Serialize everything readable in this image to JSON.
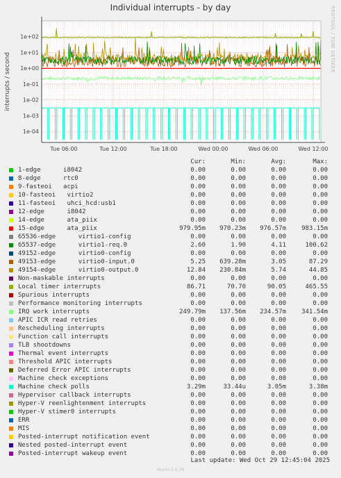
{
  "title": "Individual interrupts - by day",
  "side_label": "RRDTOOL / TOBI OETIKER",
  "columns": [
    "Cur:",
    "Min:",
    "Avg:",
    "Max:"
  ],
  "last_update": "Last update: Wed Oct 29 12:45:04 2025",
  "footer": "Munin 2.0.76",
  "chart_data": {
    "type": "line",
    "ylabel": "interrupts / second",
    "yscale": "log",
    "ylim": [
      2e-05,
      1000
    ],
    "y_ticks": [
      "1e+02",
      "1e+01",
      "1e+00",
      "1e-01",
      "1e-02",
      "1e-03",
      "1e-04"
    ],
    "y_tick_values": [
      100,
      10,
      1,
      0.1,
      0.01,
      0.001,
      0.0001
    ],
    "x_ticks": [
      "Tue 06:00",
      "Tue 12:00",
      "Tue 18:00",
      "Wed 00:00",
      "Wed 06:00",
      "Wed 12:00"
    ],
    "grid": true,
    "series": [
      {
        "name": "1-edge      i8042",
        "color": "#00cc00",
        "cur": "0.00",
        "min": "0.00",
        "avg": "0.00",
        "max": "0.00"
      },
      {
        "name": "8-edge      rtc0",
        "color": "#0066b3",
        "cur": "0.00",
        "min": "0.00",
        "avg": "0.00",
        "max": "0.00"
      },
      {
        "name": "9-fasteoi   acpi",
        "color": "#ff8000",
        "cur": "0.00",
        "min": "0.00",
        "avg": "0.00",
        "max": "0.00"
      },
      {
        "name": "10-fasteoi   virtio2",
        "color": "#ffcc00",
        "cur": "0.00",
        "min": "0.00",
        "avg": "0.00",
        "max": "0.00"
      },
      {
        "name": "11-fasteoi   uhci_hcd:usb1",
        "color": "#330099",
        "cur": "0.00",
        "min": "0.00",
        "avg": "0.00",
        "max": "0.00"
      },
      {
        "name": "12-edge      i8042",
        "color": "#990099",
        "cur": "0.00",
        "min": "0.00",
        "avg": "0.00",
        "max": "0.00"
      },
      {
        "name": "14-edge      ata_piix",
        "color": "#ccff00",
        "cur": "0.00",
        "min": "0.00",
        "avg": "0.00",
        "max": "0.00"
      },
      {
        "name": "15-edge      ata_piix",
        "color": "#ff0000",
        "cur": "979.95m",
        "min": "970.23m",
        "avg": "976.57m",
        "max": "983.15m"
      },
      {
        "name": "65536-edge      virtio1-config",
        "color": "#808080",
        "cur": "0.00",
        "min": "0.00",
        "avg": "0.00",
        "max": "0.00"
      },
      {
        "name": "65537-edge      virtio1-req.0",
        "color": "#008f00",
        "cur": "2.60",
        "min": "1.90",
        "avg": "4.11",
        "max": "100.62"
      },
      {
        "name": "49152-edge      virtio0-config",
        "color": "#00487d",
        "cur": "0.00",
        "min": "0.00",
        "avg": "0.00",
        "max": "0.00"
      },
      {
        "name": "49153-edge      virtio0-input.0",
        "color": "#b35a00",
        "cur": "5.25",
        "min": "639.28m",
        "avg": "3.05",
        "max": "87.29"
      },
      {
        "name": "49154-edge      virtio0-output.0",
        "color": "#b38f00",
        "cur": "12.84",
        "min": "230.84m",
        "avg": "5.74",
        "max": "44.85"
      },
      {
        "name": "Non-maskable interrupts",
        "color": "#6b006b",
        "cur": "0.00",
        "min": "0.00",
        "avg": "0.00",
        "max": "0.00"
      },
      {
        "name": "Local timer interrupts",
        "color": "#8fb300",
        "cur": "86.71",
        "min": "70.70",
        "avg": "90.05",
        "max": "465.55"
      },
      {
        "name": "Spurious interrupts",
        "color": "#b30000",
        "cur": "0.00",
        "min": "0.00",
        "avg": "0.00",
        "max": "0.00"
      },
      {
        "name": "Performance monitoring interrupts",
        "color": "#bebebe",
        "cur": "0.00",
        "min": "0.00",
        "avg": "0.00",
        "max": "0.00"
      },
      {
        "name": "IRQ work interrupts",
        "color": "#80ff80",
        "cur": "249.79m",
        "min": "137.56m",
        "avg": "234.57m",
        "max": "341.54m"
      },
      {
        "name": "APIC ICR read retries",
        "color": "#80c9ff",
        "cur": "0.00",
        "min": "0.00",
        "avg": "0.00",
        "max": "0.00"
      },
      {
        "name": "Rescheduling interrupts",
        "color": "#ffc080",
        "cur": "0.00",
        "min": "0.00",
        "avg": "0.00",
        "max": "0.00"
      },
      {
        "name": "Function call interrupts",
        "color": "#ffe680",
        "cur": "0.00",
        "min": "0.00",
        "avg": "0.00",
        "max": "0.00"
      },
      {
        "name": "TLB shootdowns",
        "color": "#aa80ff",
        "cur": "0.00",
        "min": "0.00",
        "avg": "0.00",
        "max": "0.00"
      },
      {
        "name": "Thermal event interrupts",
        "color": "#ee00cc",
        "cur": "0.00",
        "min": "0.00",
        "avg": "0.00",
        "max": "0.00"
      },
      {
        "name": "Threshold APIC interrupts",
        "color": "#ff8080",
        "cur": "0.00",
        "min": "0.00",
        "avg": "0.00",
        "max": "0.00"
      },
      {
        "name": "Deferred Error APIC interrupts",
        "color": "#666600",
        "cur": "0.00",
        "min": "0.00",
        "avg": "0.00",
        "max": "0.00"
      },
      {
        "name": "Machine check exceptions",
        "color": "#ffbfff",
        "cur": "0.00",
        "min": "0.00",
        "avg": "0.00",
        "max": "0.00"
      },
      {
        "name": "Machine check polls",
        "color": "#00ffcc",
        "cur": "3.29m",
        "min": "33.44u",
        "avg": "3.05m",
        "max": "3.38m"
      },
      {
        "name": "Hypervisor callback interrupts",
        "color": "#cc6699",
        "cur": "0.00",
        "min": "0.00",
        "avg": "0.00",
        "max": "0.00"
      },
      {
        "name": "Hyper-V reenlightenment interrupts",
        "color": "#999900",
        "cur": "0.00",
        "min": "0.00",
        "avg": "0.00",
        "max": "0.00"
      },
      {
        "name": "Hyper-V stimer0 interrupts",
        "color": "#00cc00",
        "cur": "0.00",
        "min": "0.00",
        "avg": "0.00",
        "max": "0.00"
      },
      {
        "name": "ERR",
        "color": "#0066b3",
        "cur": "0.00",
        "min": "0.00",
        "avg": "0.00",
        "max": "0.00"
      },
      {
        "name": "MIS",
        "color": "#ff8000",
        "cur": "0.00",
        "min": "0.00",
        "avg": "0.00",
        "max": "0.00"
      },
      {
        "name": "Posted-interrupt notification event",
        "color": "#ffcc00",
        "cur": "0.00",
        "min": "0.00",
        "avg": "0.00",
        "max": "0.00"
      },
      {
        "name": "Nested posted-interrupt event",
        "color": "#330099",
        "cur": "0.00",
        "min": "0.00",
        "avg": "0.00",
        "max": "0.00"
      },
      {
        "name": "Posted-interrupt wakeup event",
        "color": "#990099",
        "cur": "0.00",
        "min": "0.00",
        "avg": "0.00",
        "max": "0.00"
      }
    ]
  }
}
